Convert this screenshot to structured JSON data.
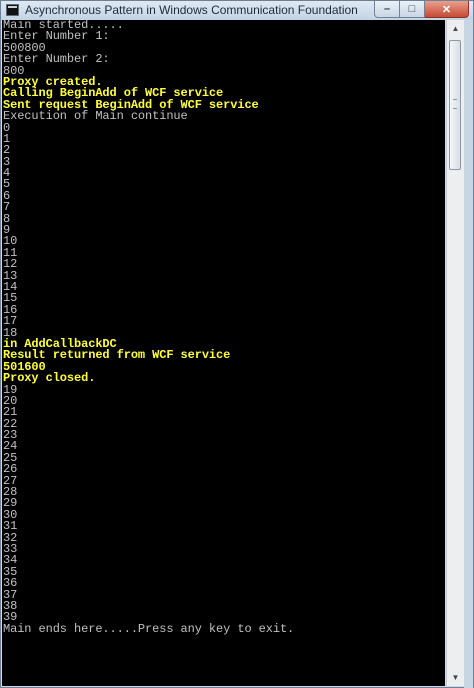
{
  "window": {
    "title": "Asynchronous Pattern in Windows Communication Foundation",
    "buttons": {
      "minimize": "–",
      "maximize": "□",
      "close": "✕"
    }
  },
  "console": {
    "colors": {
      "normal": "#c0c0c0",
      "highlight": "#ffff3c",
      "background": "#000000"
    },
    "lines": [
      {
        "text": "Main started.....",
        "style": "gray"
      },
      {
        "text": "Enter Number 1:",
        "style": "gray"
      },
      {
        "text": "500800",
        "style": "gray"
      },
      {
        "text": "Enter Number 2:",
        "style": "gray"
      },
      {
        "text": "800",
        "style": "gray"
      },
      {
        "text": "Proxy created.",
        "style": "yellow"
      },
      {
        "text": "Calling BeginAdd of WCF service",
        "style": "yellow"
      },
      {
        "text": "Sent request BeginAdd of WCF service",
        "style": "yellow"
      },
      {
        "text": "Execution of Main continue",
        "style": "gray"
      },
      {
        "text": "0",
        "style": "gray"
      },
      {
        "text": "1",
        "style": "gray"
      },
      {
        "text": "2",
        "style": "gray"
      },
      {
        "text": "3",
        "style": "gray"
      },
      {
        "text": "4",
        "style": "gray"
      },
      {
        "text": "5",
        "style": "gray"
      },
      {
        "text": "6",
        "style": "gray"
      },
      {
        "text": "7",
        "style": "gray"
      },
      {
        "text": "8",
        "style": "gray"
      },
      {
        "text": "9",
        "style": "gray"
      },
      {
        "text": "10",
        "style": "gray"
      },
      {
        "text": "11",
        "style": "gray"
      },
      {
        "text": "12",
        "style": "gray"
      },
      {
        "text": "13",
        "style": "gray"
      },
      {
        "text": "14",
        "style": "gray"
      },
      {
        "text": "15",
        "style": "gray"
      },
      {
        "text": "16",
        "style": "gray"
      },
      {
        "text": "17",
        "style": "gray"
      },
      {
        "text": "18",
        "style": "gray"
      },
      {
        "text": "in AddCallbackDC",
        "style": "yellow"
      },
      {
        "text": "Result returned from WCF service",
        "style": "yellow"
      },
      {
        "text": "501600",
        "style": "yellow"
      },
      {
        "text": "Proxy closed.",
        "style": "yellow"
      },
      {
        "text": "19",
        "style": "gray"
      },
      {
        "text": "20",
        "style": "gray"
      },
      {
        "text": "21",
        "style": "gray"
      },
      {
        "text": "22",
        "style": "gray"
      },
      {
        "text": "23",
        "style": "gray"
      },
      {
        "text": "24",
        "style": "gray"
      },
      {
        "text": "25",
        "style": "gray"
      },
      {
        "text": "26",
        "style": "gray"
      },
      {
        "text": "27",
        "style": "gray"
      },
      {
        "text": "28",
        "style": "gray"
      },
      {
        "text": "29",
        "style": "gray"
      },
      {
        "text": "30",
        "style": "gray"
      },
      {
        "text": "31",
        "style": "gray"
      },
      {
        "text": "32",
        "style": "gray"
      },
      {
        "text": "33",
        "style": "gray"
      },
      {
        "text": "34",
        "style": "gray"
      },
      {
        "text": "35",
        "style": "gray"
      },
      {
        "text": "36",
        "style": "gray"
      },
      {
        "text": "37",
        "style": "gray"
      },
      {
        "text": "38",
        "style": "gray"
      },
      {
        "text": "39",
        "style": "gray"
      },
      {
        "text": "Main ends here.....Press any key to exit.",
        "style": "gray"
      }
    ]
  },
  "scrollbar": {
    "up_icon": "chevron-up-icon",
    "down_icon": "chevron-down-icon"
  }
}
